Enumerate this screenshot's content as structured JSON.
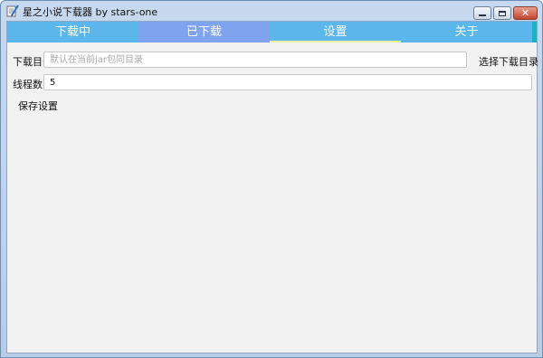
{
  "window": {
    "title": "星之小说下载器 by stars-one",
    "minimize_icon": "minimize-icon",
    "maximize_icon": "maximize-icon",
    "close_icon": "close-icon",
    "close_glyph": "✕"
  },
  "tabs": [
    {
      "label": "下载中"
    },
    {
      "label": "已下载"
    },
    {
      "label": "设置"
    },
    {
      "label": "关于"
    }
  ],
  "settings": {
    "download_dir_label": "下载目录",
    "download_dir_value": "",
    "download_dir_placeholder": "默认在当前jar包同目录",
    "choose_dir_label": "选择下载目录",
    "threads_label": "线程数",
    "threads_value": "5",
    "save_label": "保存设置"
  },
  "colors": {
    "tab_active_bg": "#5bb6ec",
    "tab_alt_bg": "#7fa3ef",
    "tab_indicator": "#e6f2a0",
    "edge_accent": "#15b5c9"
  }
}
